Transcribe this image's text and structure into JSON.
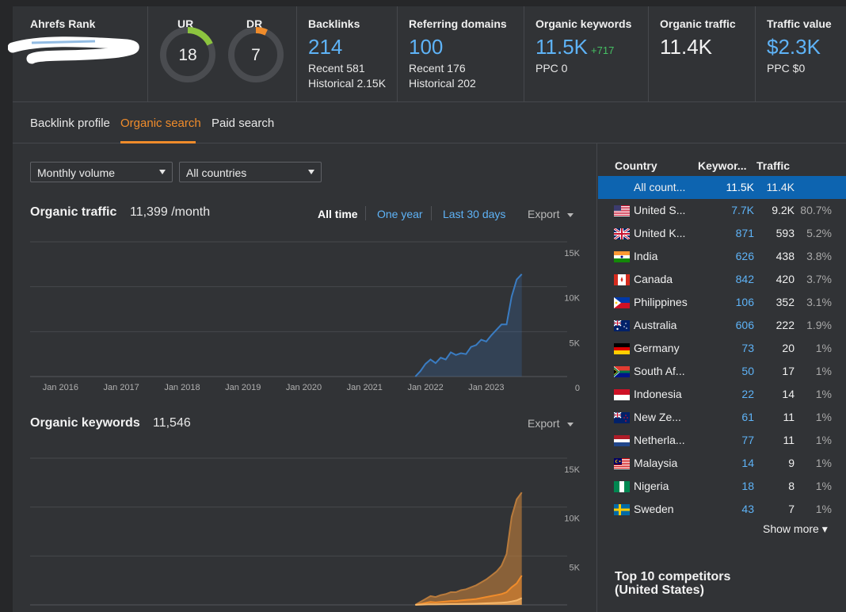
{
  "metrics": {
    "ahrefs_rank_label": "Ahrefs Rank",
    "ur": {
      "label": "UR",
      "value": "18",
      "fraction": 0.18,
      "color": "#8cc43f"
    },
    "dr": {
      "label": "DR",
      "value": "7",
      "fraction": 0.07,
      "color": "#f08c2b"
    },
    "backlinks": {
      "label": "Backlinks",
      "value": "214",
      "recent": "Recent 581",
      "historical": "Historical 2.15K"
    },
    "referring_domains": {
      "label": "Referring domains",
      "value": "100",
      "recent": "Recent 176",
      "historical": "Historical 202"
    },
    "organic_keywords": {
      "label": "Organic keywords",
      "value": "11.5K",
      "delta": "+717",
      "ppc": "PPC 0"
    },
    "organic_traffic": {
      "label": "Organic traffic",
      "value": "11.4K"
    },
    "traffic_value": {
      "label": "Traffic value",
      "value": "$2.3K",
      "ppc": "PPC $0"
    }
  },
  "tabs": [
    "Backlink profile",
    "Organic search",
    "Paid search"
  ],
  "active_tab": "Organic search",
  "filters": {
    "volume": "Monthly volume",
    "countries": "All countries"
  },
  "traffic_panel": {
    "title": "Organic traffic",
    "value": "11,399 /month",
    "ranges": [
      "All time",
      "One year",
      "Last 30 days"
    ],
    "export": "Export"
  },
  "keywords_panel": {
    "title": "Organic keywords",
    "value": "11,546",
    "export": "Export"
  },
  "chart_data": [
    {
      "type": "area",
      "title": "Organic traffic",
      "x_ticks": [
        "Jan 2016",
        "Jan 2017",
        "Jan 2018",
        "Jan 2019",
        "Jan 2020",
        "Jan 2021",
        "Jan 2022",
        "Jan 2023"
      ],
      "y_ticks": [
        "15K",
        "10K",
        "5K",
        "0"
      ],
      "ylim": [
        0,
        15000
      ],
      "series": [
        {
          "color": "#3a7cc2",
          "x": [
            "2021-11",
            "2021-12",
            "2022-01",
            "2022-02",
            "2022-03",
            "2022-04",
            "2022-05",
            "2022-06",
            "2022-07",
            "2022-08",
            "2022-09",
            "2022-10",
            "2022-11",
            "2022-12",
            "2023-01",
            "2023-02",
            "2023-03",
            "2023-04",
            "2023-05",
            "2023-06",
            "2023-07",
            "2023-08"
          ],
          "values": [
            0,
            600,
            1400,
            1900,
            1500,
            2100,
            1900,
            2700,
            2400,
            2600,
            2500,
            3300,
            3500,
            4100,
            3900,
            4600,
            5200,
            5800,
            5800,
            8900,
            10800,
            11400
          ]
        }
      ]
    },
    {
      "type": "area",
      "title": "Organic keywords",
      "y_ticks": [
        "15K",
        "10K",
        "5K"
      ],
      "ylim": [
        0,
        15000
      ],
      "series": [
        {
          "color": "#b97b3c",
          "x": [
            "2021-11",
            "2021-12",
            "2022-01",
            "2022-02",
            "2022-03",
            "2022-04",
            "2022-05",
            "2022-06",
            "2022-07",
            "2022-08",
            "2022-09",
            "2022-10",
            "2022-11",
            "2022-12",
            "2023-01",
            "2023-02",
            "2023-03",
            "2023-04",
            "2023-05",
            "2023-06",
            "2023-07",
            "2023-08"
          ],
          "values": [
            0,
            300,
            600,
            900,
            800,
            1000,
            1100,
            1300,
            1300,
            1500,
            1600,
            1800,
            2000,
            2300,
            2600,
            3000,
            3400,
            4000,
            5200,
            9000,
            10800,
            11500
          ]
        },
        {
          "color": "#f08c2b",
          "x": [
            "2021-11",
            "2021-12",
            "2022-01",
            "2022-02",
            "2022-03",
            "2022-04",
            "2022-05",
            "2022-06",
            "2022-07",
            "2022-08",
            "2022-09",
            "2022-10",
            "2022-11",
            "2022-12",
            "2023-01",
            "2023-02",
            "2023-03",
            "2023-04",
            "2023-05",
            "2023-06",
            "2023-07",
            "2023-08"
          ],
          "values": [
            0,
            100,
            200,
            300,
            250,
            300,
            350,
            400,
            400,
            450,
            500,
            550,
            600,
            700,
            800,
            900,
            1000,
            1100,
            1300,
            1800,
            2200,
            3000
          ]
        },
        {
          "color": "#f5b76b",
          "x": [
            "2021-11",
            "2021-12",
            "2022-01",
            "2022-02",
            "2022-03",
            "2022-04",
            "2022-05",
            "2022-06",
            "2022-07",
            "2022-08",
            "2022-09",
            "2022-10",
            "2022-11",
            "2022-12",
            "2023-01",
            "2023-02",
            "2023-03",
            "2023-04",
            "2023-05",
            "2023-06",
            "2023-07",
            "2023-08"
          ],
          "values": [
            0,
            20,
            40,
            60,
            50,
            60,
            70,
            80,
            80,
            90,
            100,
            110,
            120,
            140,
            160,
            180,
            200,
            230,
            260,
            350,
            450,
            700
          ]
        }
      ]
    }
  ],
  "countries": {
    "headers": [
      "Country",
      "Keywor...",
      "Traffic"
    ],
    "rows": [
      {
        "name": "All count...",
        "keywords": "11.5K",
        "traffic": "11.4K",
        "pct": "",
        "flag": "none",
        "selected": true
      },
      {
        "name": "United S...",
        "keywords": "7.7K",
        "traffic": "9.2K",
        "pct": "80.7%",
        "flag": "us"
      },
      {
        "name": "United K...",
        "keywords": "871",
        "traffic": "593",
        "pct": "5.2%",
        "flag": "uk"
      },
      {
        "name": "India",
        "keywords": "626",
        "traffic": "438",
        "pct": "3.8%",
        "flag": "in"
      },
      {
        "name": "Canada",
        "keywords": "842",
        "traffic": "420",
        "pct": "3.7%",
        "flag": "ca"
      },
      {
        "name": "Philippines",
        "keywords": "106",
        "traffic": "352",
        "pct": "3.1%",
        "flag": "ph"
      },
      {
        "name": "Australia",
        "keywords": "606",
        "traffic": "222",
        "pct": "1.9%",
        "flag": "au"
      },
      {
        "name": "Germany",
        "keywords": "73",
        "traffic": "20",
        "pct": "1%",
        "flag": "de"
      },
      {
        "name": "South Af...",
        "keywords": "50",
        "traffic": "17",
        "pct": "1%",
        "flag": "za"
      },
      {
        "name": "Indonesia",
        "keywords": "22",
        "traffic": "14",
        "pct": "1%",
        "flag": "id"
      },
      {
        "name": "New Ze...",
        "keywords": "61",
        "traffic": "11",
        "pct": "1%",
        "flag": "nz"
      },
      {
        "name": "Netherla...",
        "keywords": "77",
        "traffic": "11",
        "pct": "1%",
        "flag": "nl"
      },
      {
        "name": "Malaysia",
        "keywords": "14",
        "traffic": "9",
        "pct": "1%",
        "flag": "my"
      },
      {
        "name": "Nigeria",
        "keywords": "18",
        "traffic": "8",
        "pct": "1%",
        "flag": "ng"
      },
      {
        "name": "Sweden",
        "keywords": "43",
        "traffic": "7",
        "pct": "1%",
        "flag": "se"
      }
    ],
    "show_more": "Show more ▾"
  },
  "competitors_title": "Top 10 competitors (United States)"
}
